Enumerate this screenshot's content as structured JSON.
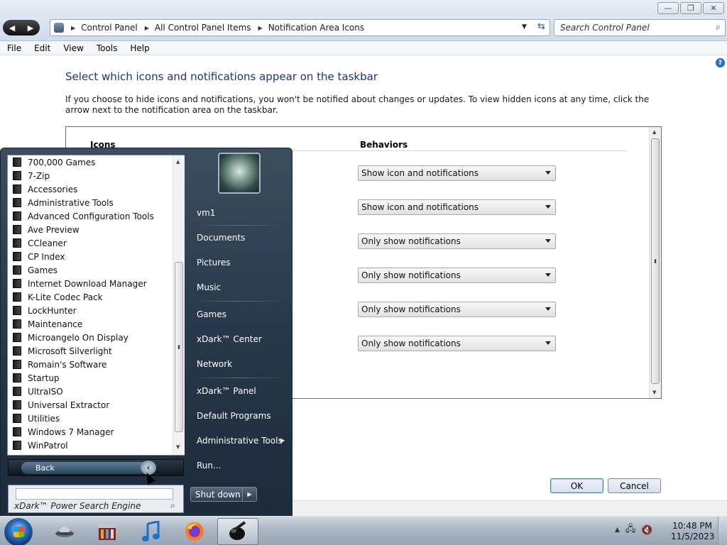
{
  "window": {
    "minimize_glyph": "—",
    "maximize_glyph": "❐",
    "close_glyph": "✕"
  },
  "address": {
    "back_glyph": "◀",
    "forward_glyph": "▶",
    "crumbs": [
      "Control Panel",
      "All Control Panel Items",
      "Notification Area Icons"
    ],
    "search_placeholder": "Search Control Panel"
  },
  "menu": [
    "File",
    "Edit",
    "View",
    "Tools",
    "Help"
  ],
  "page": {
    "title": "Select which icons and notifications appear on the taskbar",
    "description": "If you choose to hide icons and notifications, you won't be notified about changes or updates. To view hidden icons at any time, click the arrow next to the notification area on the taskbar.",
    "col_icons": "Icons",
    "col_behaviors": "Behaviors",
    "behaviors": [
      "Show icon and notifications",
      "Show icon and notifications",
      "Only show notifications",
      "Only show notifications",
      "Only show notifications",
      "Only show notifications"
    ],
    "ok": "OK",
    "cancel": "Cancel"
  },
  "start_menu": {
    "programs": [
      "700,000 Games",
      "7-Zip",
      "Accessories",
      "Administrative Tools",
      "Advanced Configuration Tools",
      "Ave Preview",
      "CCleaner",
      "CP Index",
      "Games",
      "Internet Download Manager",
      "K-Lite Codec Pack",
      "LockHunter",
      "Maintenance",
      "Microangelo On Display",
      "Microsoft Silverlight",
      "Romain's Software",
      "Startup",
      "UltraISO",
      "Universal Extractor",
      "Utilities",
      "Windows 7 Manager",
      "WinPatrol"
    ],
    "back": "Back",
    "search_label": "xDark™ Power Search Engine",
    "right_items": {
      "user": "vm1",
      "documents": "Documents",
      "pictures": "Pictures",
      "music": "Music",
      "games": "Games",
      "xdark_center": "xDark™ Center",
      "network": "Network",
      "xdark_panel": "xDark™ Panel",
      "default_programs": "Default Programs",
      "administrative_tools": "Administrative Tools",
      "run": "Run..."
    },
    "shutdown": "Shut down"
  },
  "taskbar": {
    "time": "10:48 PM",
    "date": "11/5/2023"
  }
}
